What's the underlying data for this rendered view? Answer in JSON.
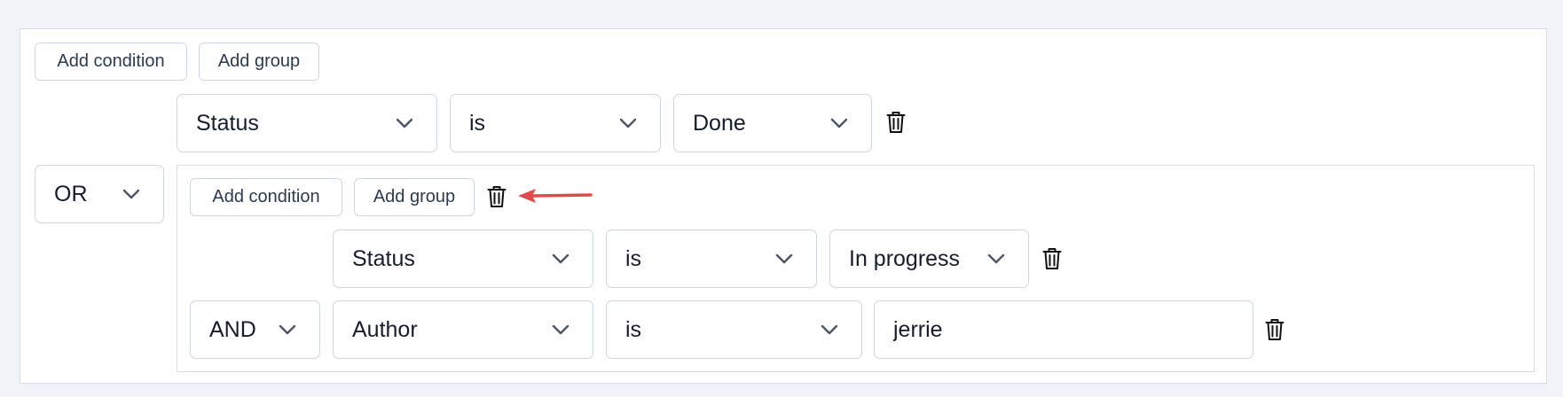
{
  "root": {
    "add_condition_label": "Add condition",
    "add_group_label": "Add group",
    "combinator": "OR",
    "rule1": {
      "field": "Status",
      "operator": "is",
      "value": "Done"
    },
    "group": {
      "add_condition_label": "Add condition",
      "add_group_label": "Add group",
      "combinator": "AND",
      "rule1": {
        "field": "Status",
        "operator": "is",
        "value": "In progress"
      },
      "rule2": {
        "field": "Author",
        "operator": "is",
        "value": "jerrie"
      }
    }
  },
  "colors": {
    "annotation_arrow": "#e04a4a",
    "border": "#cdd6e3",
    "background": "#f0f3f8"
  },
  "icons": {
    "remove": "trash-icon",
    "dropdown": "chevron-down-icon"
  }
}
